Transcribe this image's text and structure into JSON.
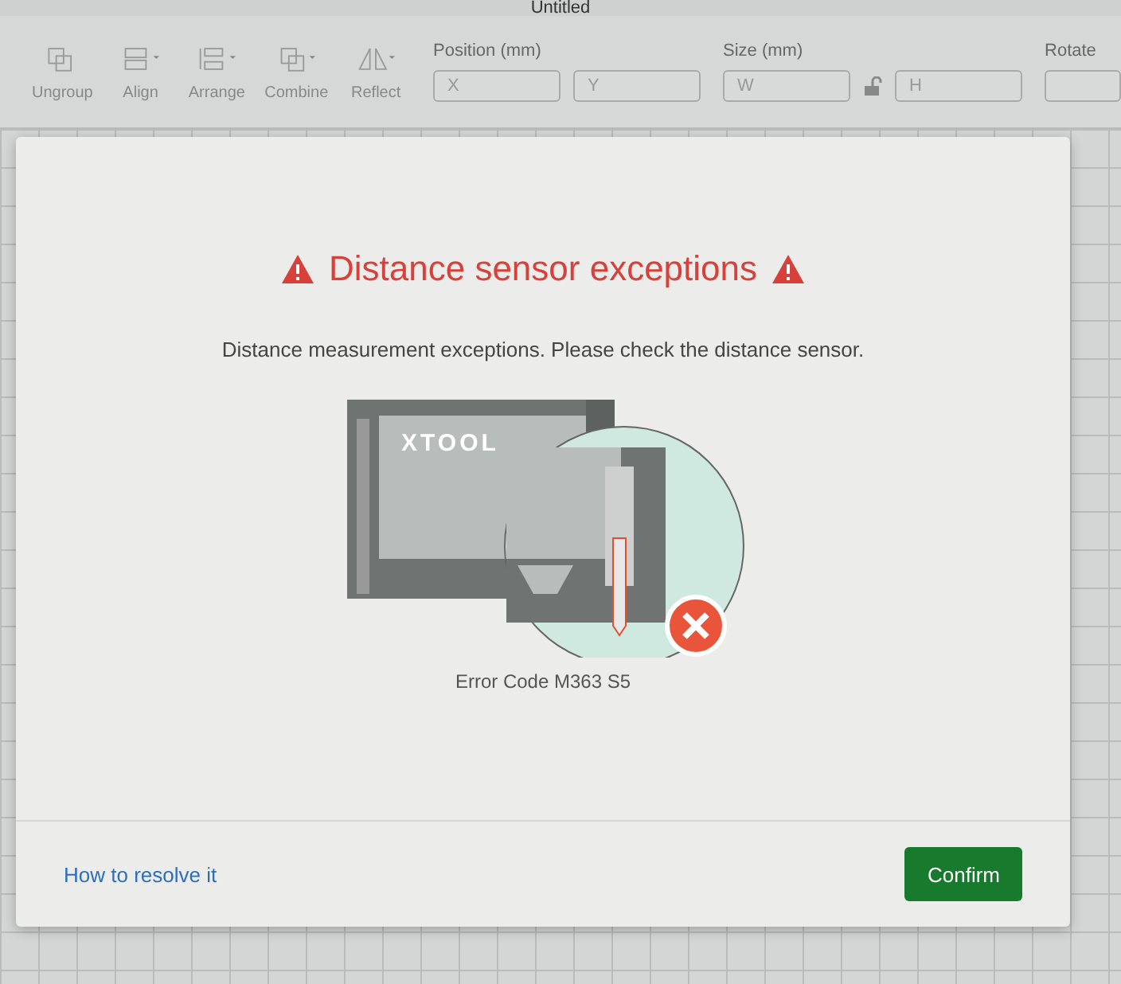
{
  "window": {
    "title": "Untitled"
  },
  "toolbar": {
    "tools": [
      {
        "label": "Ungroup",
        "dropdown": false
      },
      {
        "label": "Align",
        "dropdown": true
      },
      {
        "label": "Arrange",
        "dropdown": true
      },
      {
        "label": "Combine",
        "dropdown": true
      },
      {
        "label": "Reflect",
        "dropdown": true
      }
    ],
    "position": {
      "label": "Position (mm)",
      "fields": [
        {
          "placeholder": "X"
        },
        {
          "placeholder": "Y"
        }
      ]
    },
    "size": {
      "label": "Size (mm)",
      "fields": [
        {
          "placeholder": "W"
        },
        {
          "placeholder": "H"
        }
      ],
      "locked": false
    },
    "rotate": {
      "label": "Rotate"
    }
  },
  "dialog": {
    "title": "Distance sensor exceptions",
    "message": "Distance measurement exceptions. Please check the distance sensor.",
    "illustration_label": "XTOOL",
    "error_code": "Error Code M363 S5",
    "help_link": "How to resolve it",
    "confirm_button": "Confirm"
  }
}
